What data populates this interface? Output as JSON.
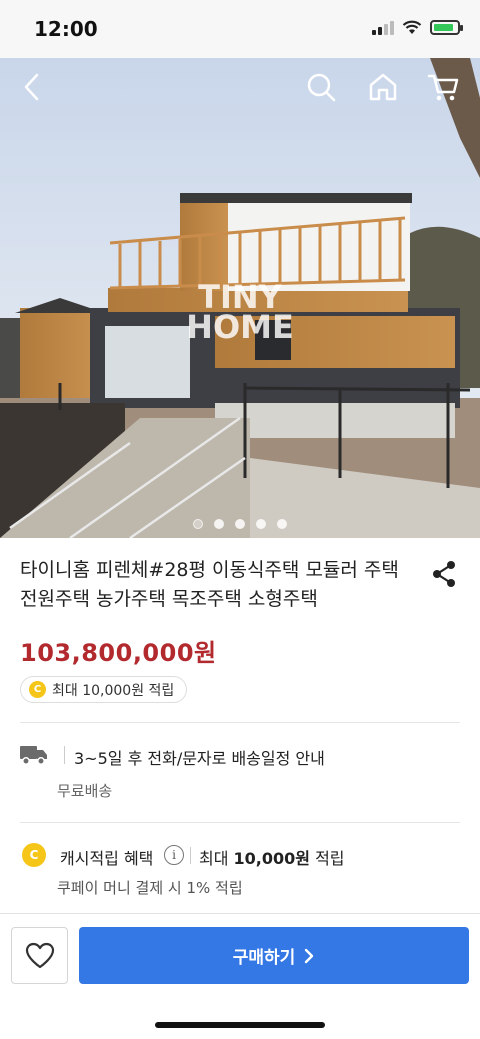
{
  "status_bar": {
    "time": "12:00",
    "battery_level": 0.85
  },
  "nav": {
    "icons": [
      "back-icon",
      "search-icon",
      "home-icon",
      "cart-icon"
    ]
  },
  "hero": {
    "watermark_line1": "TINY",
    "watermark_line2": "HOME",
    "slide_count": 5,
    "active_slide": 1
  },
  "product": {
    "title": "타이니홈 피렌체#28평 이동식주택 모듈러 주택 전원주택 농가주택 목조주택 소형주택",
    "price": "103,800,000원",
    "reward": "최대 10,000원 적립"
  },
  "delivery": {
    "schedule": "3~5일 후 전화/문자로 배송일정 안내",
    "shipping": "무료배송"
  },
  "cash": {
    "label": "캐시적립 혜택",
    "max_prefix": "최대 ",
    "max_amount": "10,000원",
    "max_suffix": " 적립",
    "note": "쿠페이 머니 결제 시 1% 적립",
    "coin_letter": "C"
  },
  "bottom": {
    "buy_label": "구매하기"
  },
  "colors": {
    "price": "#b2292e",
    "buy_button": "#3478e5",
    "coin": "#f5c518"
  }
}
